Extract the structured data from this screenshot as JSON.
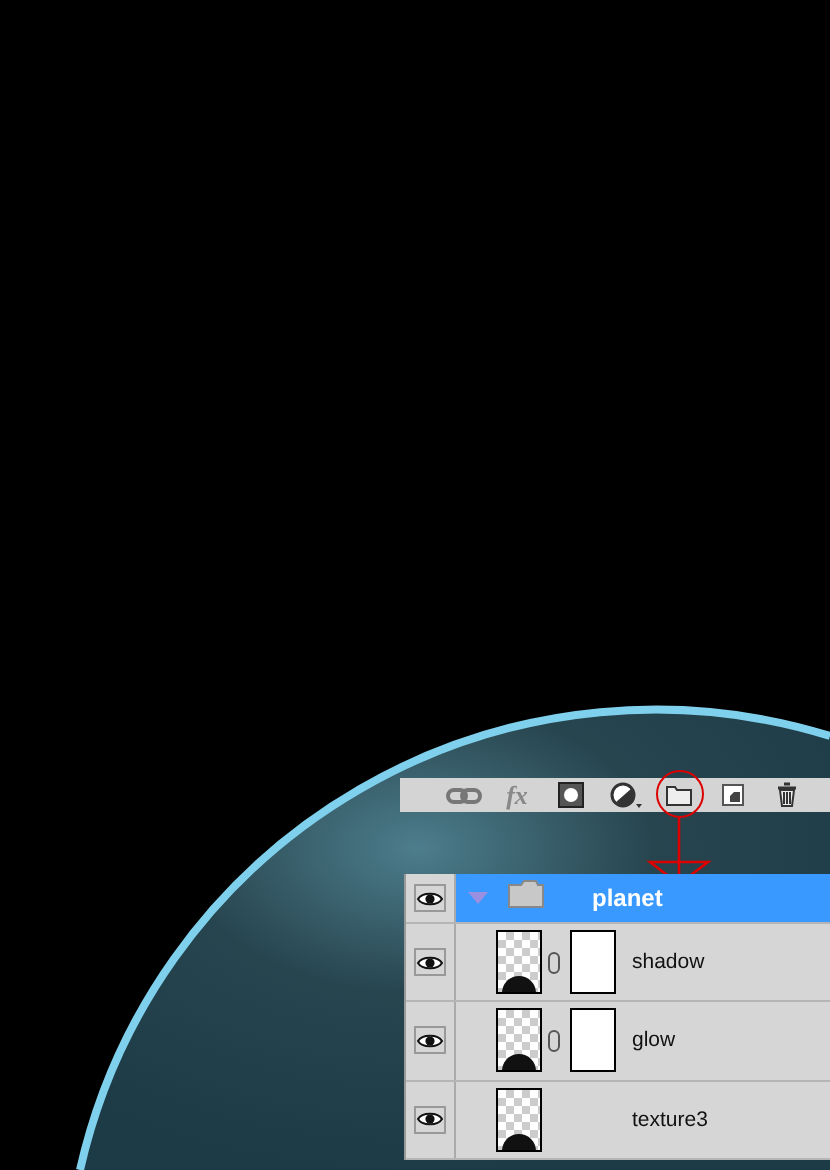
{
  "toolbar": {
    "items": [
      {
        "kind": "link",
        "circled": false
      },
      {
        "kind": "fx",
        "label": "fx",
        "circled": false
      },
      {
        "kind": "mask",
        "circled": false
      },
      {
        "kind": "adjustment",
        "circled": false
      },
      {
        "kind": "group",
        "circled": true
      },
      {
        "kind": "new",
        "circled": false
      },
      {
        "kind": "trash",
        "circled": false
      }
    ]
  },
  "layers": [
    {
      "kind": "group",
      "name": "planet",
      "visible": true,
      "selected": true,
      "expanded": true
    },
    {
      "kind": "layer",
      "name": "shadow",
      "visible": true,
      "selected": false,
      "mask": true
    },
    {
      "kind": "layer",
      "name": "glow",
      "visible": true,
      "selected": false,
      "mask": true
    },
    {
      "kind": "layer",
      "name": "texture3",
      "visible": true,
      "selected": false,
      "mask": false
    }
  ]
}
